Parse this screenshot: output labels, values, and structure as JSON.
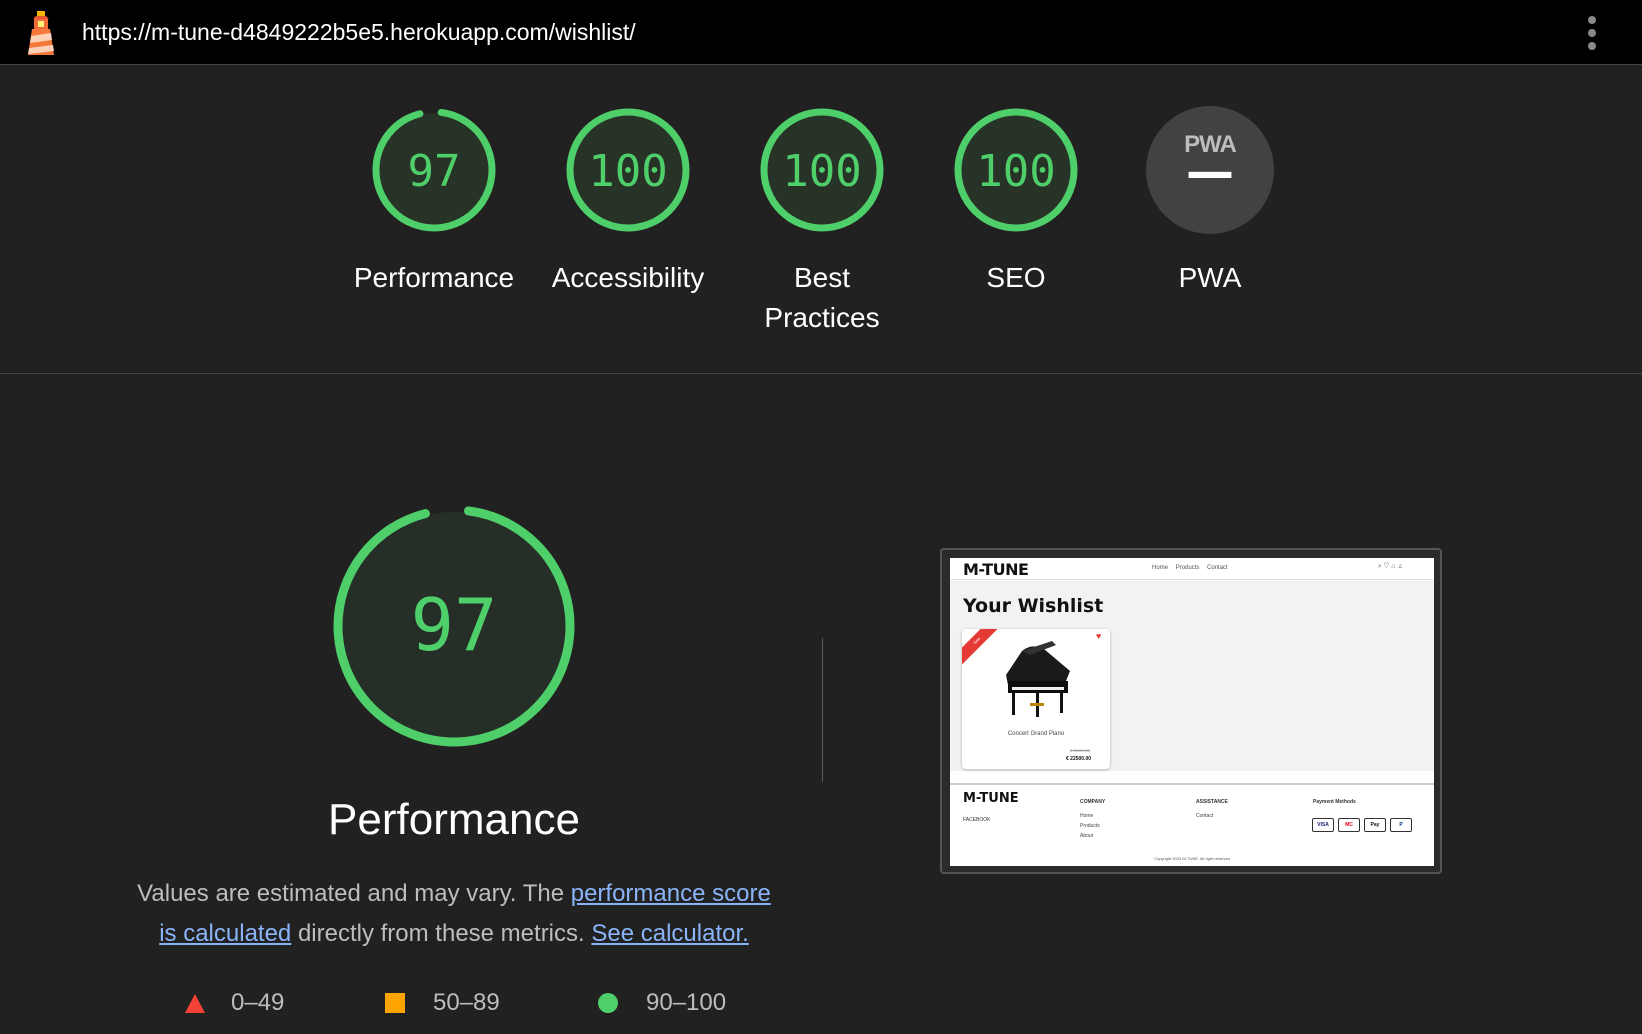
{
  "browser": {
    "url": "https://m-tune-d4849222b5e5.herokuapp.com/wishlist/"
  },
  "categories": [
    {
      "id": "performance",
      "label": "Performance",
      "score": "97",
      "fraction": 0.97,
      "color": "#4fcf6a"
    },
    {
      "id": "accessibility",
      "label": "Accessibility",
      "score": "100",
      "fraction": 1.0,
      "color": "#4fcf6a"
    },
    {
      "id": "best-practices",
      "label_line1": "Best",
      "label_line2": "Practices",
      "score": "100",
      "fraction": 1.0,
      "color": "#4fcf6a"
    },
    {
      "id": "seo",
      "label": "SEO",
      "score": "100",
      "fraction": 1.0,
      "color": "#4fcf6a"
    },
    {
      "id": "pwa",
      "label": "PWA",
      "badge": "PWA",
      "score": "—",
      "color": "#7a7a7a"
    }
  ],
  "main": {
    "score": "97",
    "fraction": 0.97,
    "title": "Performance",
    "desc_before": "Values are estimated and may vary. The ",
    "desc_link1": "performance score is calculated",
    "desc_middle": " directly from these metrics. ",
    "desc_link2": "See calculator."
  },
  "legend": {
    "fail": "0–49",
    "average": "50–89",
    "pass": "90–100",
    "colors": {
      "fail": "#f44336",
      "average": "#ffa400",
      "pass": "#4fcf6a"
    }
  },
  "screenshot": {
    "brand": "M-TUNE",
    "nav_links": [
      "Home",
      "Products",
      "Contact"
    ],
    "heading": "Your Wishlist",
    "ribbon": "Sale",
    "product_name": "Concert Grand Piano",
    "old_price": "€ 25000.00",
    "price": "€ 22500.00",
    "footer": {
      "brand": "M-TUNE",
      "facebook": "FACEBOOK",
      "company_heading": "COMPANY",
      "company_links": [
        "Home",
        "Products",
        "About"
      ],
      "assistance_heading": "ASSISTANCE",
      "assistance_links": [
        "Contact"
      ],
      "payment_heading": "Payment Methods",
      "payment_methods": [
        "VISA",
        "MC",
        "Pay",
        "P"
      ],
      "copyright": "Copyright 2023 M-TUNE. All right reserved"
    }
  }
}
